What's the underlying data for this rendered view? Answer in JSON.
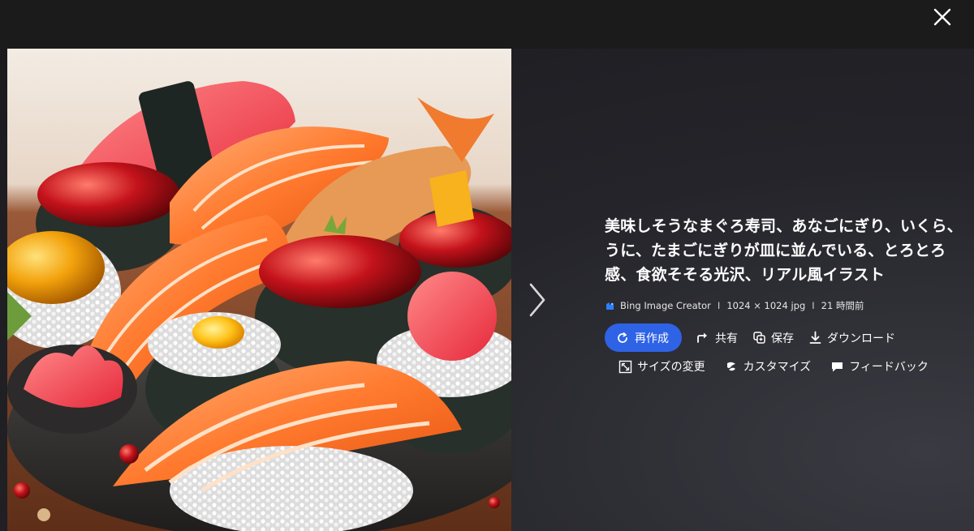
{
  "viewer": {
    "close_icon": "close-icon",
    "next_icon": "chevron-right-icon"
  },
  "image": {
    "subject": "sushi-illustration"
  },
  "info": {
    "title": "美味しそうなまぐろ寿司、あなごにぎり、いくら、うに、たまごにぎりが皿に並んでいる、とろとろ感、食欲そそる光沢、リアル風イラスト",
    "source": "Bing Image Creator",
    "separator": "I",
    "dimensions": "1024 × 1024 jpg",
    "time": "21 時間前"
  },
  "actions": {
    "regenerate": "再作成",
    "share": "共有",
    "save": "保存",
    "download": "ダウンロード",
    "resize": "サイズの変更",
    "customize": "カスタマイズ",
    "feedback": "フィードバック"
  },
  "colors": {
    "accent": "#2f63e6",
    "background": "#1b1b1b"
  }
}
